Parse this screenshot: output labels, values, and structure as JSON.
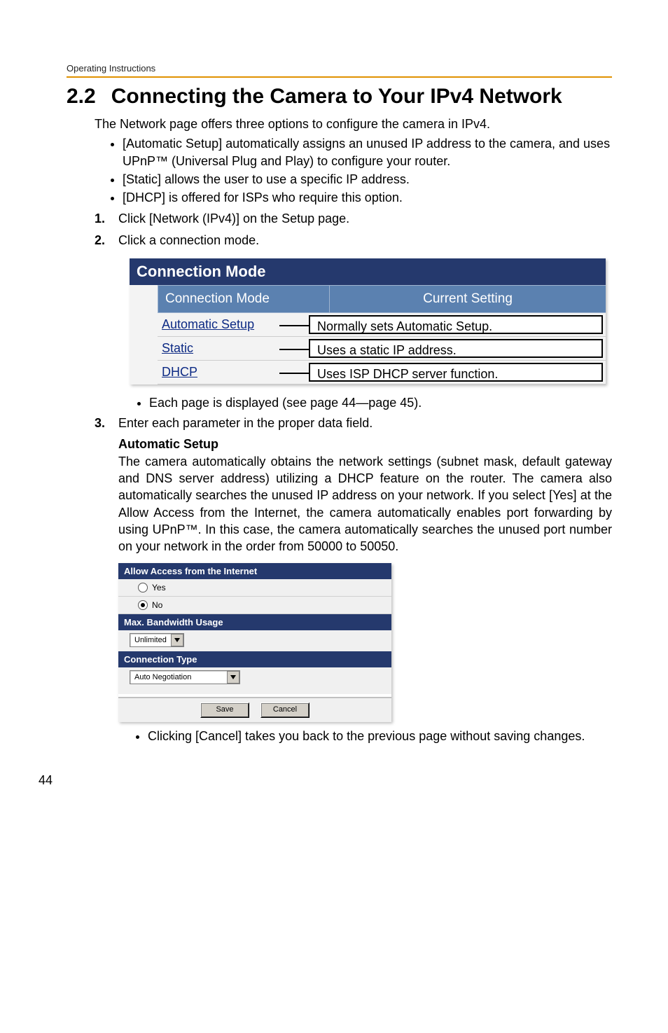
{
  "running_head": "Operating Instructions",
  "heading": {
    "number": "2.2",
    "title": "Connecting the Camera to Your IPv4 Network"
  },
  "intro": "The Network page offers three options to configure the camera in IPv4.",
  "intro_bullets": [
    "[Automatic Setup] automatically assigns an unused IP address to the camera, and uses UPnP™ (Universal Plug and Play) to configure your router.",
    "[Static] allows the user to use a specific IP address.",
    "[DHCP] is offered for ISPs who require this option."
  ],
  "steps": {
    "s1": {
      "num": "1.",
      "text": "Click [Network (IPv4)] on the Setup page."
    },
    "s2": {
      "num": "2.",
      "text": "Click a connection mode."
    },
    "s3": {
      "num": "3.",
      "text": "Enter each parameter in the proper data field."
    }
  },
  "conn_mode": {
    "title": "Connection Mode",
    "header_left": "Connection Mode",
    "header_right": "Current Setting",
    "rows": [
      {
        "link": "Automatic Setup",
        "desc": "Normally sets Automatic Setup."
      },
      {
        "link": "Static",
        "desc": "Uses a static IP address."
      },
      {
        "link": "DHCP",
        "desc": "Uses ISP DHCP server function."
      }
    ]
  },
  "mid_bullet": "Each page is displayed (see page 44—page 45).",
  "auto_setup": {
    "title": "Automatic Setup",
    "para": "The camera automatically obtains the network settings (subnet mask, default gateway and DNS server address) utilizing a DHCP feature on the router. The camera also automatically searches the unused IP address on your network. If you select [Yes] at the Allow Access from the Internet, the camera automatically enables port forwarding by using UPnP™. In this case, the camera automatically searches the unused port number on your network in the order from 50000 to 50050."
  },
  "settings_fig": {
    "sec1_title": "Allow Access from the Internet",
    "opt_yes": "Yes",
    "opt_no": "No",
    "opt_no_selected": true,
    "sec2_title": "Max. Bandwidth Usage",
    "dd_bandwidth": "Unlimited",
    "sec3_title": "Connection Type",
    "dd_conn": "Auto Negotiation",
    "btn_save": "Save",
    "btn_cancel": "Cancel"
  },
  "post_fig_bullet": "Clicking [Cancel] takes you back to the previous page without saving changes.",
  "page_number": "44"
}
